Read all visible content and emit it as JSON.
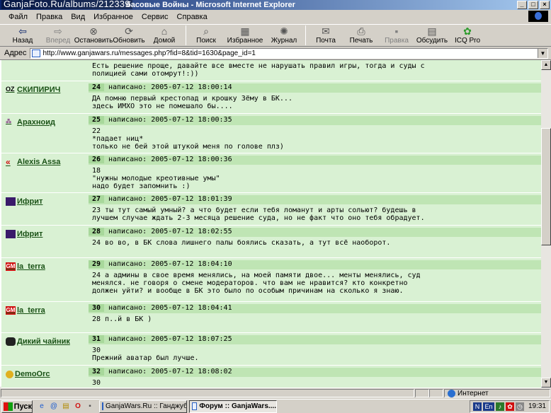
{
  "window": {
    "title": "басовые Войны - Microsoft Internet Explorer",
    "watermark": "GanjaFoto.Ru/albums/212339"
  },
  "menu": [
    "Файл",
    "Правка",
    "Вид",
    "Избранное",
    "Сервис",
    "Справка"
  ],
  "toolbar": [
    {
      "label": "Назад",
      "icon": "back-arrow-icon",
      "enabled": true
    },
    {
      "label": "Вперед",
      "icon": "forward-arrow-icon",
      "enabled": false
    },
    {
      "label": "Остановить",
      "icon": "stop-icon",
      "enabled": true
    },
    {
      "label": "Обновить",
      "icon": "refresh-icon",
      "enabled": true
    },
    {
      "label": "Домой",
      "icon": "home-icon",
      "enabled": true
    },
    {
      "label": "Поиск",
      "icon": "search-icon",
      "enabled": true
    },
    {
      "label": "Избранное",
      "icon": "favorites-icon",
      "enabled": true
    },
    {
      "label": "Журнал",
      "icon": "history-icon",
      "enabled": true
    },
    {
      "label": "Почта",
      "icon": "mail-icon",
      "enabled": true
    },
    {
      "label": "Печать",
      "icon": "print-icon",
      "enabled": true
    },
    {
      "label": "Правка",
      "icon": "edit-icon",
      "enabled": false
    },
    {
      "label": "Обсудить",
      "icon": "discuss-icon",
      "enabled": true
    },
    {
      "label": "ICQ Pro",
      "icon": "icq-icon",
      "enabled": true
    }
  ],
  "address": {
    "label": "Адрес",
    "url": "http://www.ganjawars.ru/messages.php?fid=8&tid=1630&page_id=1"
  },
  "posts": [
    {
      "author": "",
      "avatar": "",
      "number": "",
      "date": "",
      "body": "Есть решение проще, давайте все вместе не нарушать правил игры, тогда и суды с\nполицией сами отомрут!:))"
    },
    {
      "author": "СКИПИРИЧ",
      "avatar": "oz-avatar",
      "number": "24",
      "date": "написано: 2005-07-12 18:00:14",
      "body": "ДА помню первый крестопад и крошку Зёму в БК...\nздесь ИМХО это не помешало бы...."
    },
    {
      "author": "Арахноид",
      "avatar": "spider-avatar",
      "number": "25",
      "date": "написано: 2005-07-12 18:00:35",
      "body": "22\n*падает ниц*\nтолько не бей этой штукой меня по голове плз)"
    },
    {
      "author": "Alexis Assa",
      "avatar": "chevrons-avatar",
      "number": "26",
      "date": "написано: 2005-07-12 18:00:36",
      "body": "18\n\"нужны молодые креотивные умы\"\nнадо будет запомнить :)"
    },
    {
      "author": "Ифрит",
      "avatar": "ifrit-avatar",
      "number": "27",
      "date": "написано: 2005-07-12 18:01:39",
      "body": "23 ты тут самый умный? а что будет если тебя ломанут и арты сольют? будешь в\nлучшем случае ждать 2-3 месяца решение суда, но не факт что оно тебя обрадует."
    },
    {
      "author": "Ифрит",
      "avatar": "ifrit-avatar",
      "number": "28",
      "date": "написано: 2005-07-12 18:02:55",
      "body": "24 во во, в БК слова лишнего палы боялись сказать, а тут всё наоборот."
    },
    {
      "author": "la_terra",
      "avatar": "gm-avatar",
      "number": "29",
      "date": "написано: 2005-07-12 18:04:10",
      "body": "24 а админы в свое время менялись, на моей памяти двое... менты менялись, суд\nменялся. не говоря о смене модераторов. что вам не нравится? кто конкретно\nдолжен уйти? и вообще в БК это было по особым причинам на сколько я знаю."
    },
    {
      "author": "la_terra",
      "avatar": "gm-avatar",
      "number": "30",
      "date": "написано: 2005-07-12 18:04:41",
      "body": "28 п..й в БК )"
    },
    {
      "author": "Дикий чайник",
      "avatar": "teapot-avatar",
      "number": "31",
      "date": "написано: 2005-07-12 18:07:25",
      "body": "30\nПрежний аватар был лучше."
    },
    {
      "author": "DemoOrc",
      "avatar": "orc-avatar",
      "number": "32",
      "date": "написано: 2005-07-12 18:08:02",
      "body": "30"
    }
  ],
  "status": {
    "zone": "Интернет"
  },
  "taskbar": {
    "start": "Пуск",
    "tasks": [
      "GanjaWars.Ru :: Ганджуб...",
      "Форум :: GanjaWars...."
    ],
    "lang": "En",
    "time": "19:31"
  }
}
